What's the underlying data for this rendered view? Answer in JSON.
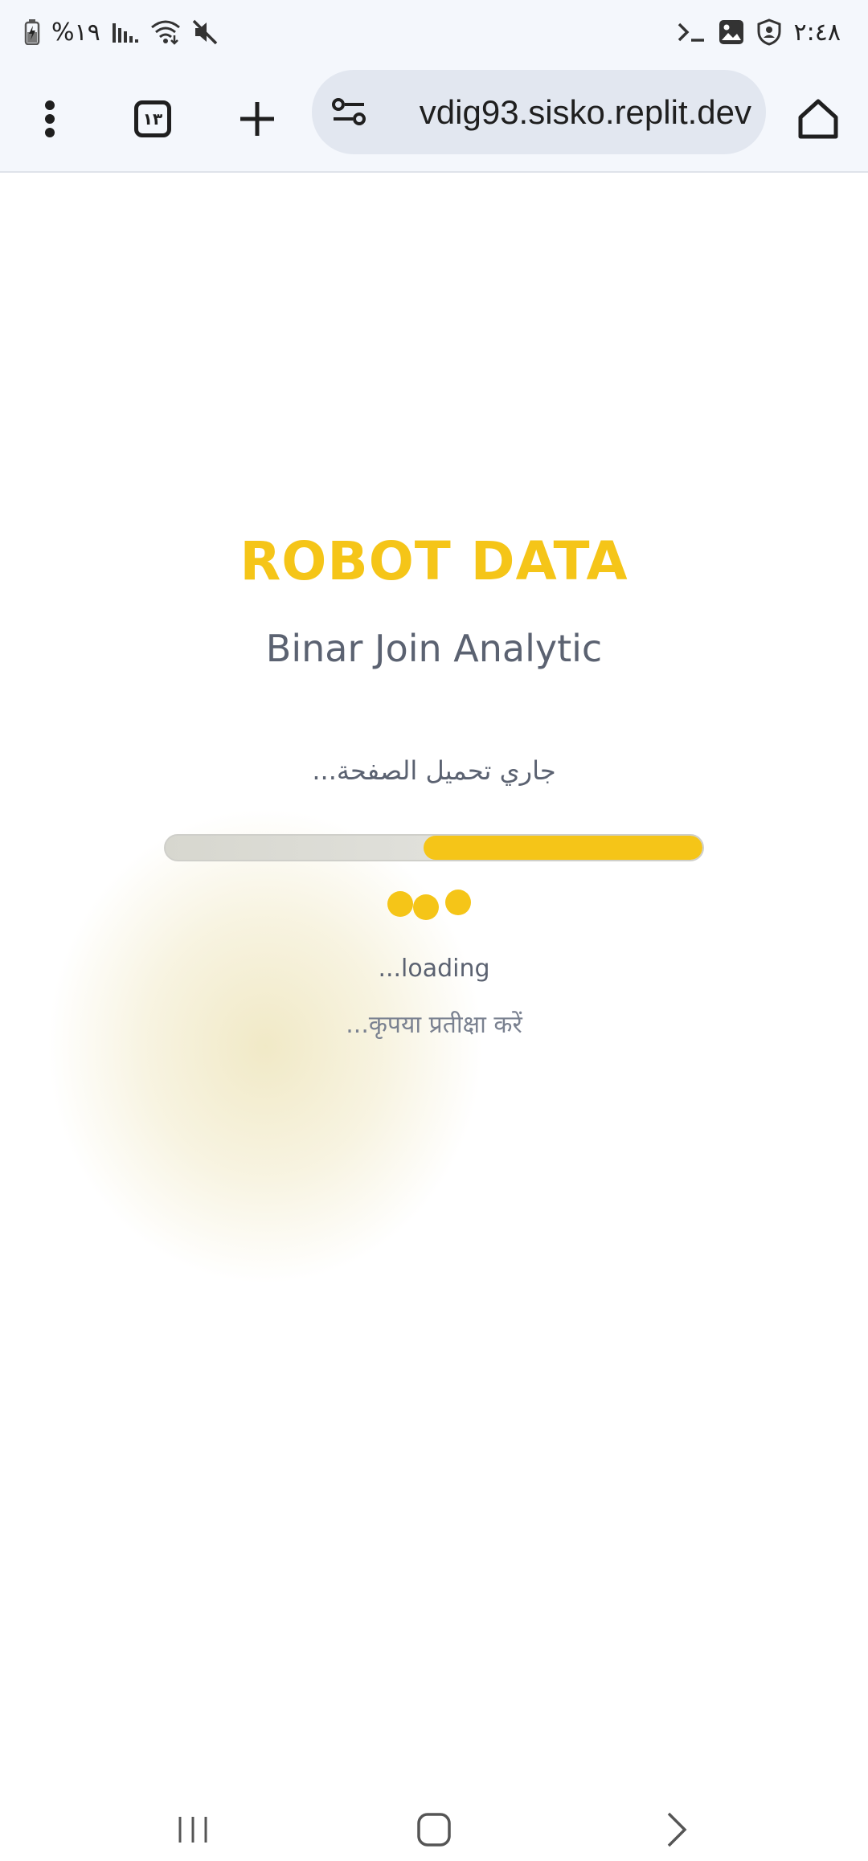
{
  "status_bar": {
    "battery_text": "%١٩",
    "time": "٢:٤٨",
    "icons_left": [
      "battery-charging-icon",
      "signal-icon",
      "wifi-icon",
      "mute-icon"
    ],
    "icons_right": [
      "terminal-icon",
      "gallery-icon",
      "shield-icon"
    ]
  },
  "browser": {
    "menu_icon": "more-vert-icon",
    "tab_count": "١٣",
    "new_tab_icon": "plus-icon",
    "url": "vdig93.sisko.replit.dev",
    "site_settings_icon": "tune-icon",
    "home_icon": "home-icon"
  },
  "page": {
    "title": "ROBOT DATA",
    "subtitle": "Binar Join Analytic",
    "arabic_loading": "جاري تحميل الصفحة...",
    "progress_fraction": 0.52,
    "loading_text": "...loading",
    "hindi_wait": "...कृपया प्रतीक्षा करें",
    "accent_color": "#f5c518",
    "text_color": "#5b6271"
  },
  "nav_bar": {
    "icons": [
      "recents-icon",
      "home-icon",
      "back-icon"
    ]
  }
}
